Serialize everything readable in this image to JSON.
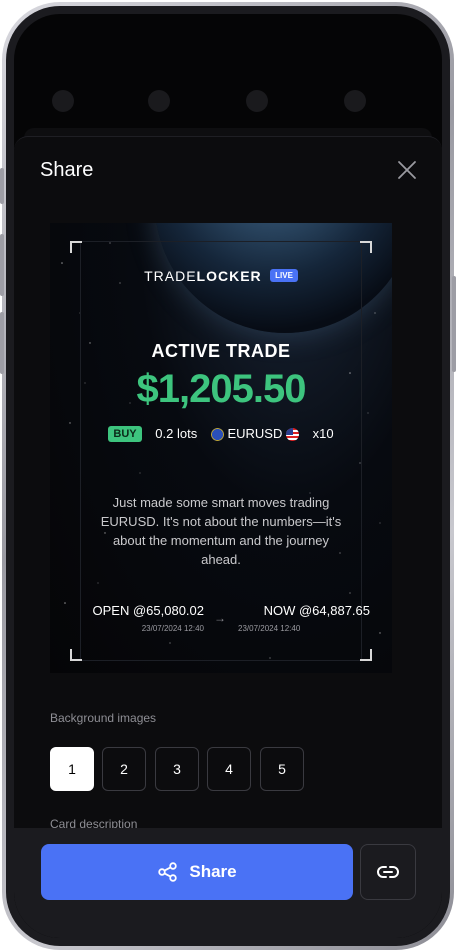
{
  "sheet": {
    "title": "Share"
  },
  "card": {
    "logo_light": "TRADE",
    "logo_bold": "LOCKER",
    "live_badge": "LIVE",
    "heading": "ACTIVE TRADE",
    "amount": "$1,205.50",
    "side": "BUY",
    "lots": "0.2 lots",
    "symbol": "EURUSD",
    "leverage": "x10",
    "description": "Just made some smart moves trading EURUSD. It's not about the numbers—it's about the momentum and the journey ahead.",
    "open_label": "OPEN @65,080.02",
    "open_time": "23/07/2024 12:40",
    "now_label": "NOW @64,887.65",
    "now_time": "23/07/2024 12:40",
    "colors": {
      "profit": "#3dc47e",
      "accent": "#4a72f5"
    }
  },
  "background_images": {
    "label": "Background images",
    "options": [
      "1",
      "2",
      "3",
      "4",
      "5"
    ],
    "selected": "1"
  },
  "card_description": {
    "label": "Card description"
  },
  "actions": {
    "share_label": "Share"
  },
  "icons": [
    "close-icon",
    "share-icon",
    "link-icon",
    "arrow-right-icon",
    "eu-flag-icon",
    "us-flag-icon"
  ]
}
